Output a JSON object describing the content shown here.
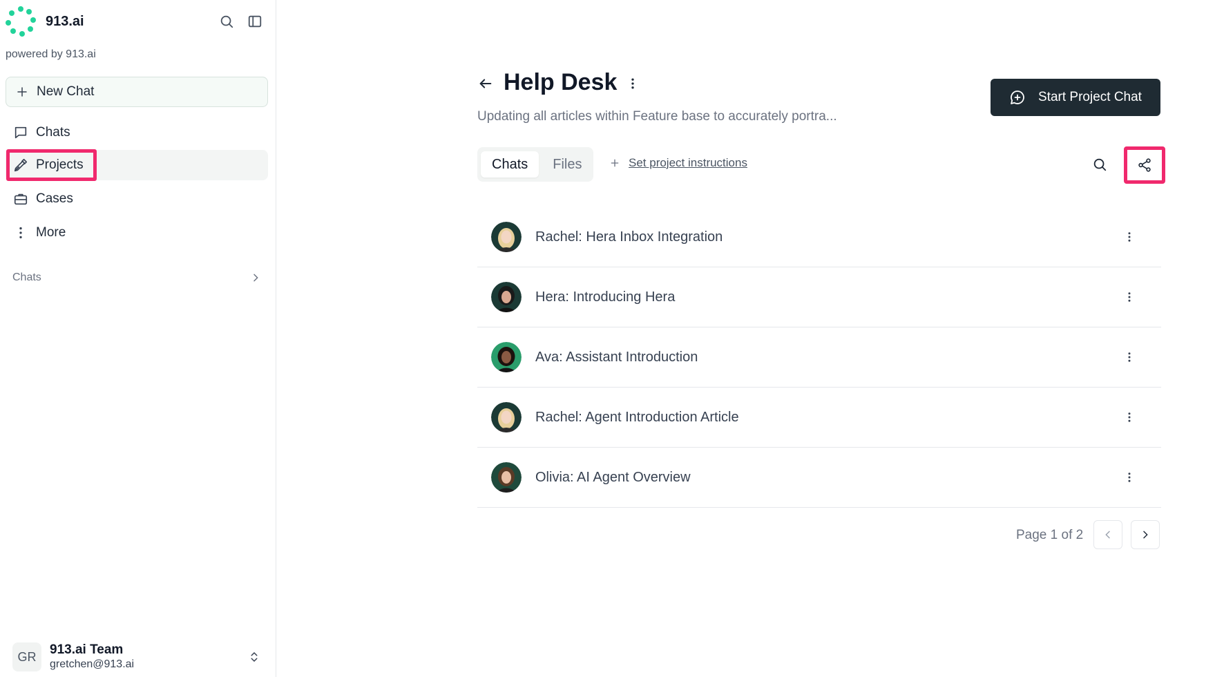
{
  "sidebar": {
    "brand": "913.ai",
    "powered_by": "powered by 913.ai",
    "new_chat_label": "New Chat",
    "nav": [
      {
        "label": "Chats",
        "icon": "message-square-icon"
      },
      {
        "label": "Projects",
        "icon": "pen-tool-icon"
      },
      {
        "label": "Cases",
        "icon": "briefcase-icon"
      },
      {
        "label": "More",
        "icon": "more-vertical-icon"
      }
    ],
    "section_label": "Chats",
    "user": {
      "initials": "GR",
      "name": "913.ai Team",
      "email": "gretchen@913.ai"
    }
  },
  "header": {
    "title": "Help Desk",
    "subtitle": "Updating all articles within Feature base to accurately portra...",
    "start_chat_label": "Start Project Chat"
  },
  "tabs": [
    {
      "label": "Chats",
      "active": true
    },
    {
      "label": "Files",
      "active": false
    }
  ],
  "instructions_label": "Set project instructions",
  "chats": [
    {
      "title": "Rachel: Hera Inbox Integration",
      "avatar": "rachel"
    },
    {
      "title": "Hera: Introducing Hera",
      "avatar": "hera"
    },
    {
      "title": "Ava: Assistant Introduction",
      "avatar": "ava"
    },
    {
      "title": "Rachel: Agent Introduction Article",
      "avatar": "rachel"
    },
    {
      "title": "Olivia: AI Agent Overview",
      "avatar": "olivia"
    }
  ],
  "pagination": {
    "label": "Page 1 of 2"
  },
  "colors": {
    "accent": "#22d39a",
    "highlight": "#f0296d",
    "primary_button": "#1f2b33"
  }
}
